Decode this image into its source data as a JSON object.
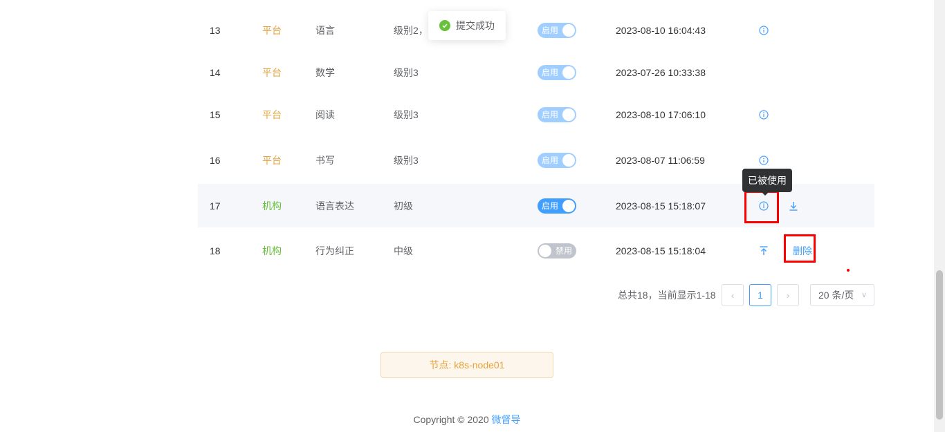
{
  "table": {
    "rows": [
      {
        "idx": "13",
        "source": "平台",
        "source_type": "platform",
        "name": "语言",
        "level": "级别2，级",
        "switch": "启用",
        "switch_state": "on-faded",
        "time": "2023-08-10 16:04:43",
        "act1": "info",
        "act2": ""
      },
      {
        "idx": "14",
        "source": "平台",
        "source_type": "platform",
        "name": "数学",
        "level": "级别3",
        "switch": "启用",
        "switch_state": "on-faded",
        "time": "2023-07-26 10:33:38",
        "act1": "",
        "act2": ""
      },
      {
        "idx": "15",
        "source": "平台",
        "source_type": "platform",
        "name": "阅读",
        "level": "级别3",
        "switch": "启用",
        "switch_state": "on-faded",
        "time": "2023-08-10 17:06:10",
        "act1": "info",
        "act2": ""
      },
      {
        "idx": "16",
        "source": "平台",
        "source_type": "platform",
        "name": "书写",
        "level": "级别3",
        "switch": "启用",
        "switch_state": "on-faded",
        "time": "2023-08-07 11:06:59",
        "act1": "info",
        "act2": ""
      },
      {
        "idx": "17",
        "source": "机构",
        "source_type": "org",
        "name": "语言表达",
        "level": "初级",
        "switch": "启用",
        "switch_state": "on",
        "time": "2023-08-15 15:18:07",
        "act1": "info",
        "act2": "download"
      },
      {
        "idx": "18",
        "source": "机构",
        "source_type": "org",
        "name": "行为纠正",
        "level": "中级",
        "switch": "禁用",
        "switch_state": "off",
        "time": "2023-08-15 15:18:04",
        "act1": "upload",
        "act2": "删除"
      }
    ]
  },
  "toast": {
    "message": "提交成功"
  },
  "tooltip": {
    "text": "已被使用"
  },
  "pagination": {
    "total_text": "总共18，当前显示1-18",
    "current_page": "1",
    "page_size": "20 条/页"
  },
  "node_tag": "节点: k8s-node01",
  "footer": {
    "copyright": "Copyright © 2020 ",
    "brand": "微督导"
  },
  "colors": {
    "primary": "#409eff",
    "platform": "#e6a23c",
    "org": "#67c23a",
    "success": "#67c23a",
    "highlight": "#ff0000"
  }
}
